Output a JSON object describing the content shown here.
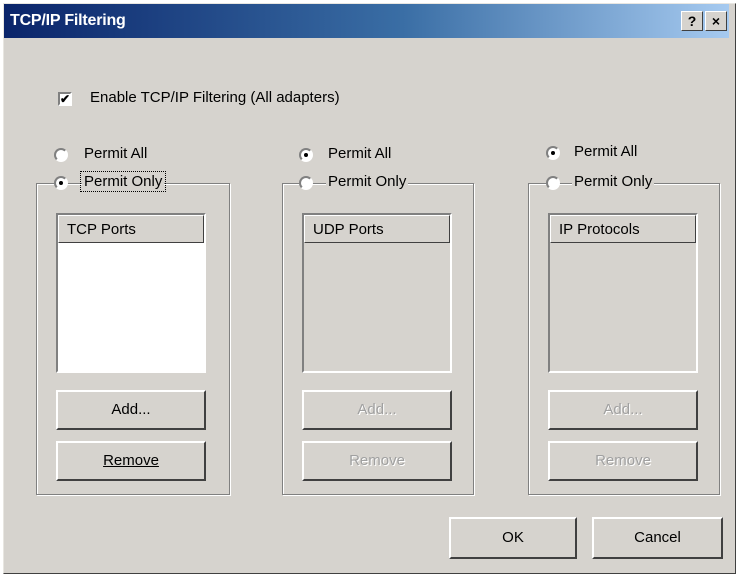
{
  "window": {
    "title": "TCP/IP Filtering",
    "help_glyph": "?",
    "close_glyph": "×"
  },
  "enable": {
    "label": "Enable TCP/IP Filtering (All adapters)",
    "checked": true
  },
  "tcp": {
    "permit_all": "Permit All",
    "permit_only": "Permit Only",
    "selected": "permit_only",
    "header": "TCP Ports",
    "add": "Add...",
    "remove": "Remove"
  },
  "udp": {
    "permit_all": "Permit All",
    "permit_only": "Permit Only",
    "selected": "permit_all",
    "header": "UDP Ports",
    "add": "Add...",
    "remove": "Remove"
  },
  "ip": {
    "permit_all": "Permit All",
    "permit_only": "Permit Only",
    "selected": "permit_all",
    "header": "IP Protocols",
    "add": "Add...",
    "remove": "Remove"
  },
  "footer": {
    "ok": "OK",
    "cancel": "Cancel"
  }
}
